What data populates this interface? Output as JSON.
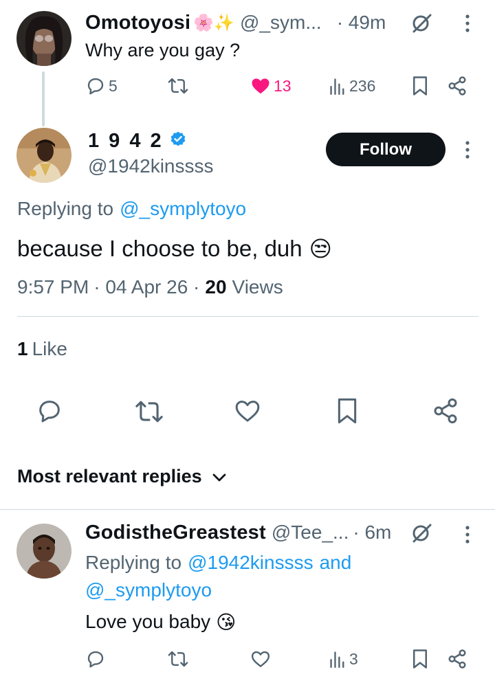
{
  "parent_tweet": {
    "display_name": "Omotoyosi",
    "emojis": "🌸✨",
    "handle": "@_sym...",
    "time": "· 49m",
    "text": "Why are you gay ?",
    "replies": "5",
    "likes": "13",
    "views": "236"
  },
  "main_tweet": {
    "display_name": "1 9 4 2",
    "handle": "@1942kinssss",
    "follow_label": "Follow",
    "replying_prefix": "Replying to",
    "replying_to": "@_symplytoyo",
    "text": "because I choose to be, duh",
    "text_emoji": "😒",
    "time": "9:57 PM",
    "date": "· 04 Apr 26 ·",
    "views_count": "20",
    "views_label": "Views",
    "likes_count": "1",
    "likes_label": "Like"
  },
  "replies_section": {
    "sort_label": "Most relevant replies"
  },
  "reply_tweet": {
    "display_name": "GodistheGreastest",
    "handle": "@Tee_...",
    "time": "· 6m",
    "replying_prefix": "Replying to",
    "replying_to_1": "@1942kinssss",
    "and_label": "and",
    "replying_to_2": "@_symplytoyo",
    "text": "Love you baby",
    "text_emoji": "😘",
    "views": "3"
  },
  "colors": {
    "accent": "#1d9bf0",
    "like": "#f91880",
    "muted": "#536471",
    "text": "#0f1419"
  }
}
